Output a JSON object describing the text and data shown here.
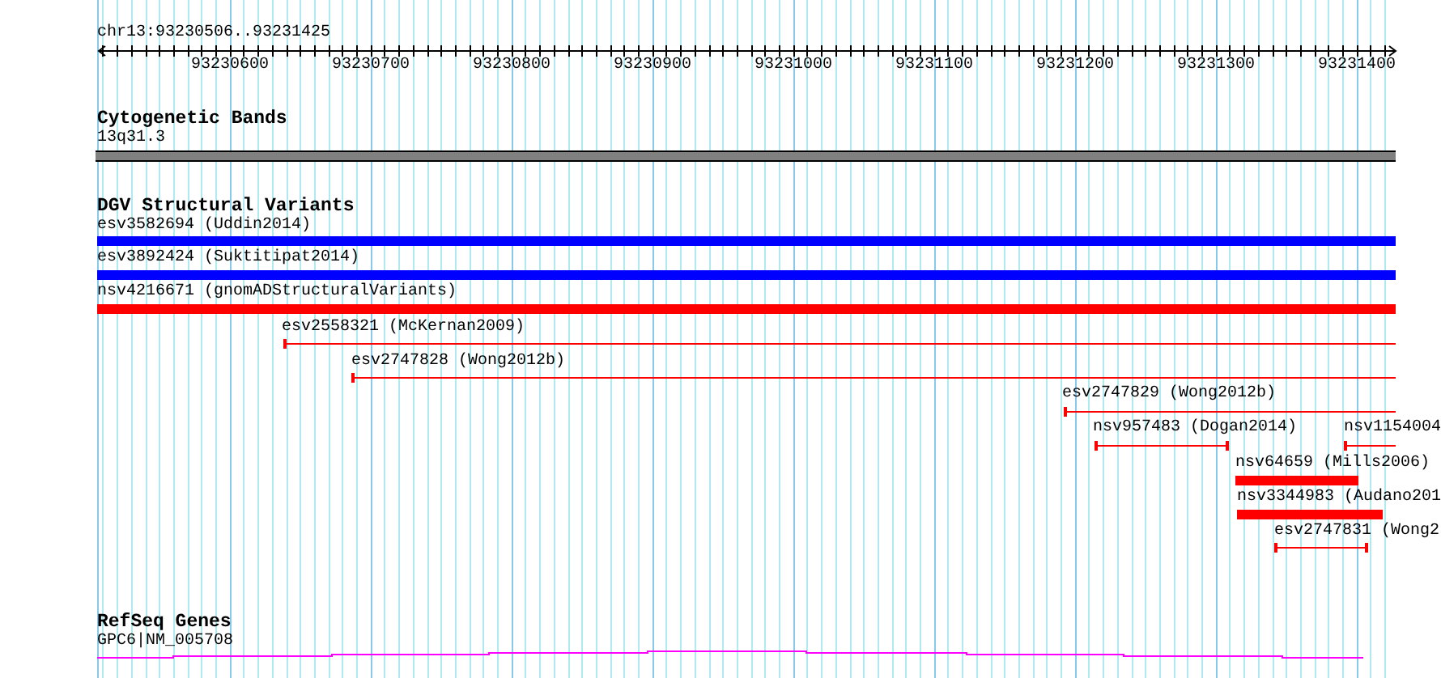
{
  "ruler": {
    "region": "chr13:93230506..93231425",
    "ticks": [
      "93230600",
      "93230700",
      "93230800",
      "93230900",
      "93231000",
      "93231100",
      "93231200",
      "93231300",
      "93231400"
    ]
  },
  "tracks": [
    {
      "title": "Cytogenetic Bands",
      "features": [
        {
          "label": "13q31.3",
          "kind": "band",
          "color": "#808080"
        }
      ]
    },
    {
      "title": "DGV Structural Variants",
      "features": [
        {
          "label": "esv3582694 (Uddin2014)",
          "kind": "bar",
          "color": "#0000ff"
        },
        {
          "label": "esv3892424 (Suktitipat2014)",
          "kind": "bar",
          "color": "#0000ff"
        },
        {
          "label": "nsv4216671 (gnomADStructuralVariants)",
          "kind": "bar",
          "color": "#ff0000"
        },
        {
          "label": "esv2558321 (McKernan2009)",
          "kind": "line",
          "color": "#ff0000"
        },
        {
          "label": "esv2747828 (Wong2012b)",
          "kind": "line",
          "color": "#ff0000"
        },
        {
          "label": "esv2747829 (Wong2012b)",
          "kind": "line",
          "color": "#ff0000"
        },
        {
          "label": "nsv957483 (Dogan2014)",
          "kind": "line",
          "color": "#ff0000"
        },
        {
          "label": "nsv1154004",
          "kind": "line",
          "color": "#ff0000"
        },
        {
          "label": "nsv64659 (Mills2006)",
          "kind": "bar",
          "color": "#ff0000"
        },
        {
          "label": "nsv3344983 (Audano201",
          "kind": "bar",
          "color": "#ff0000"
        },
        {
          "label": "esv2747831 (Wong2",
          "kind": "line",
          "color": "#ff0000"
        }
      ]
    },
    {
      "title": "RefSeq Genes",
      "features": [
        {
          "label": "GPC6|NM_005708",
          "kind": "gene",
          "color": "#ff00ff"
        }
      ]
    }
  ]
}
